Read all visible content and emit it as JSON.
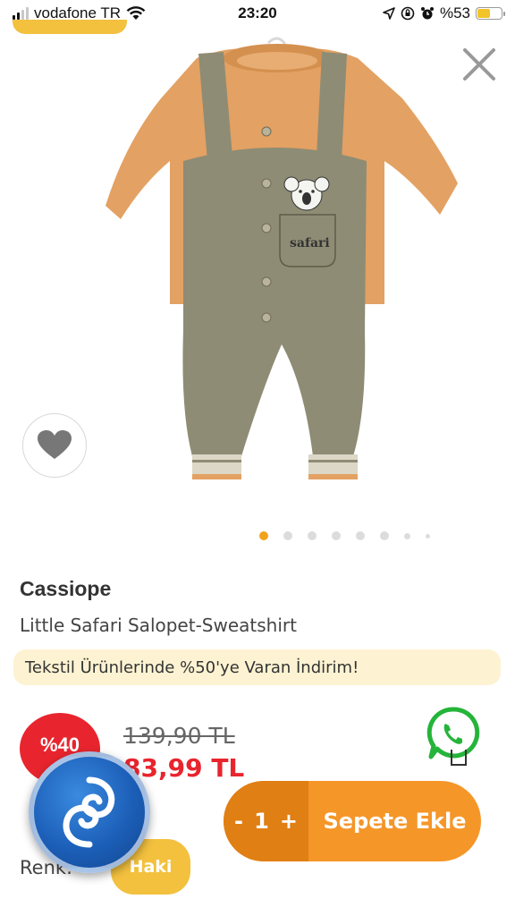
{
  "status_bar": {
    "carrier": "vodafone TR",
    "time": "23:20",
    "battery_text": "%53",
    "icons": [
      "signal-icon",
      "wifi-icon",
      "location-icon",
      "lock-rotation-icon",
      "alarm-icon",
      "battery-icon"
    ]
  },
  "product": {
    "brand": "Cassiope",
    "name": "Little Safari Salopet-Sweatshirt",
    "promo": "Tekstil Ürünlerinde %50'ye Varan İndirim!",
    "discount_badge": "%40",
    "old_price": "139,90 TL",
    "new_price": "83,99 TL",
    "pocket_text": "safari",
    "image_dots": 8,
    "active_dot": 0
  },
  "cart": {
    "minus": "-",
    "quantity": "1",
    "plus": "+",
    "add_label": "Sepete Ekle"
  },
  "color": {
    "label": "Renk:",
    "selected": "Haki"
  },
  "colors": {
    "accent": "#f59628",
    "accent_dark": "#e07f14",
    "sale_red": "#e8252e",
    "chip_yellow": "#f3c13e",
    "promo_bg": "#fdf3d2",
    "whatsapp_green": "#25b43a"
  }
}
